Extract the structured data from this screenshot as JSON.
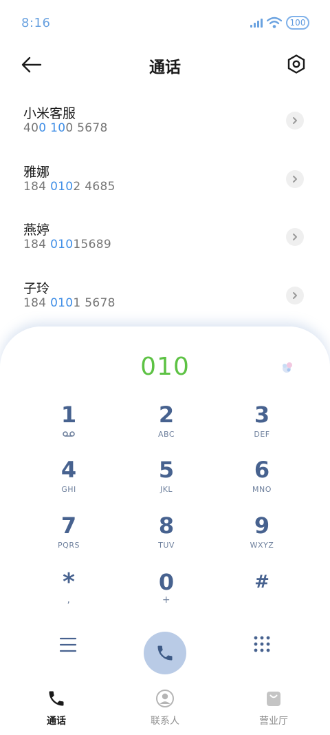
{
  "status": {
    "time": "8:16",
    "battery": "100",
    "accent": "#6aa2e0"
  },
  "header": {
    "title": "通话"
  },
  "contacts": [
    {
      "name": "小米客服",
      "number_parts": [
        "40",
        "0",
        " ",
        "10",
        "0 5678"
      ],
      "hl": [
        false,
        true,
        false,
        true,
        false
      ]
    },
    {
      "name": "雅娜",
      "number_parts": [
        "184 ",
        "010",
        "2 4685"
      ],
      "hl": [
        false,
        true,
        false
      ]
    },
    {
      "name": "燕婷",
      "number_parts": [
        "184 ",
        "010",
        "15689"
      ],
      "hl": [
        false,
        true,
        false
      ]
    },
    {
      "name": "子玲",
      "number_parts": [
        "184 ",
        "010",
        "1 5678"
      ],
      "hl": [
        false,
        true,
        false
      ]
    }
  ],
  "dialer": {
    "display": "010",
    "display_color": "#5dc244",
    "keys": [
      {
        "digit": "1",
        "letters": "voicemail-icon"
      },
      {
        "digit": "2",
        "letters": "ABC"
      },
      {
        "digit": "3",
        "letters": "DEF"
      },
      {
        "digit": "4",
        "letters": "GHI"
      },
      {
        "digit": "5",
        "letters": "JKL"
      },
      {
        "digit": "6",
        "letters": "MNO"
      },
      {
        "digit": "7",
        "letters": "PQRS"
      },
      {
        "digit": "8",
        "letters": "TUV"
      },
      {
        "digit": "9",
        "letters": "WXYZ"
      },
      {
        "digit": "*",
        "letters": ","
      },
      {
        "digit": "0",
        "letters": "+"
      },
      {
        "digit": "#",
        "letters": ""
      }
    ]
  },
  "nav": {
    "items": [
      {
        "label": "通话",
        "icon": "phone-icon",
        "active": true
      },
      {
        "label": "联系人",
        "icon": "person-icon",
        "active": false
      },
      {
        "label": "营业厅",
        "icon": "bag-icon",
        "active": false
      }
    ]
  }
}
